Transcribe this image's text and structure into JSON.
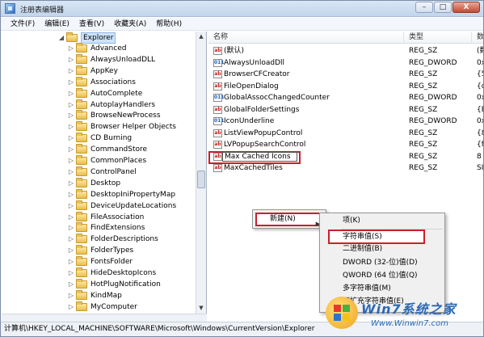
{
  "window": {
    "title": "注册表编辑器",
    "btn_min": "–",
    "btn_max": "□",
    "btn_close": "X"
  },
  "menu": [
    "文件(F)",
    "编辑(E)",
    "查看(V)",
    "收藏夹(A)",
    "帮助(H)"
  ],
  "tree": {
    "selected": "Explorer",
    "children": [
      "Advanced",
      "AlwaysUnloadDLL",
      "AppKey",
      "Associations",
      "AutoComplete",
      "AutoplayHandlers",
      "BrowseNewProcess",
      "Browser Helper Objects",
      "CD Burning",
      "CommandStore",
      "CommonPlaces",
      "ControlPanel",
      "Desktop",
      "DesktopIniPropertyMap",
      "DeviceUpdateLocations",
      "FileAssociation",
      "FindExtensions",
      "FolderDescriptions",
      "FolderTypes",
      "FontsFolder",
      "HideDesktopIcons",
      "HotPlugNotification",
      "KindMap",
      "MyComputer"
    ]
  },
  "list": {
    "headers": {
      "name": "名称",
      "type": "类型",
      "data": "数"
    },
    "rows": [
      {
        "name": "(默认)",
        "type": "REG_SZ",
        "data": "(数",
        "icon": "string"
      },
      {
        "name": "AlwaysUnloadDll",
        "type": "REG_DWORD",
        "data": "0x",
        "icon": "dword"
      },
      {
        "name": "BrowserCFCreator",
        "type": "REG_SZ",
        "data": "{5",
        "icon": "string"
      },
      {
        "name": "FileOpenDialog",
        "type": "REG_SZ",
        "data": "{d",
        "icon": "string"
      },
      {
        "name": "GlobalAssocChangedCounter",
        "type": "REG_DWORD",
        "data": "0x",
        "icon": "dword"
      },
      {
        "name": "GlobalFolderSettings",
        "type": "REG_SZ",
        "data": "{E",
        "icon": "string"
      },
      {
        "name": "IconUnderline",
        "type": "REG_DWORD",
        "data": "0x",
        "icon": "dword"
      },
      {
        "name": "ListViewPopupControl",
        "type": "REG_SZ",
        "data": "{8",
        "icon": "string"
      },
      {
        "name": "LVPopupSearchControl",
        "type": "REG_SZ",
        "data": "{f",
        "icon": "string"
      },
      {
        "name": "Max Cached Icons",
        "type": "REG_SZ",
        "data": "8",
        "icon": "string",
        "editing": true
      },
      {
        "name": "MaxCachedTiles",
        "type": "REG_SZ",
        "data": "SI",
        "icon": "string"
      }
    ]
  },
  "context_menu": {
    "main_item": "新建(N)",
    "submenu": [
      "项(K)",
      "字符串值(S)",
      "二进制值(B)",
      "DWORD (32-位)值(D)",
      "QWORD (64 位)值(Q)",
      "多字符串值(M)",
      "可扩充字符串值(E)"
    ],
    "highlighted": "字符串值(S)"
  },
  "statusbar": {
    "path": "计算机\\HKEY_LOCAL_MACHINE\\SOFTWARE\\Microsoft\\Windows\\CurrentVersion\\Explorer"
  },
  "watermark": {
    "title": "Win7系统之家",
    "url": "Www.Winwin7.com"
  }
}
